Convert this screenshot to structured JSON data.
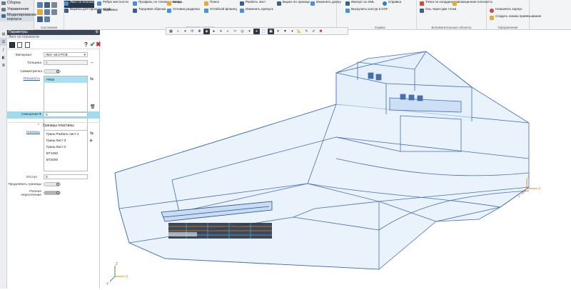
{
  "left_nav": {
    "items": [
      "Сборка",
      "Управление",
      "Моделирование корпуса"
    ]
  },
  "ribbon": {
    "group_labels": {
      "system": "Системная",
      "hull": "Элементы корпуса",
      "service": "Сервис",
      "aux": "Вспомогательные объекты",
      "design": "Оформление"
    },
    "buttons": {
      "sheet": "Лист по плоскости",
      "cutout": "Вырезы для прохода проф.",
      "rib": "Ребро жесткости",
      "stiffener": "Задвижка",
      "profile_points": "Профиль по точкам и напра...",
      "end_profile": "Торцевая обрезка",
      "bracket": "Кница",
      "corner_cut": "Угловая разделка",
      "search": "Поиск",
      "flange": "Отгибной фланец",
      "split_sheet": "Разбить лист",
      "change_allowance": "Изменить припуск",
      "cutout_border": "Вырез по границе",
      "change_length": "Изменить длину",
      "import_xml": "Импорт из XML",
      "help": "Справка",
      "export_dxf": "Выгрузить контур в DXF",
      "point_coords": "Точка по координатам",
      "axis_two_points": "Ось через две точки",
      "offset_plane": "Смещенная плоскость",
      "assign_hull": "Назначить корпус",
      "create_weld": "Создать линию привязывания"
    }
  },
  "panel": {
    "title": "Параметры",
    "subtitle": "Лист по плоскости",
    "material_label": "Материал",
    "material_value": "Лист s8.0 PCB",
    "thickness_label": "Толщина",
    "thickness_value": "8",
    "symmetric_label": "Симметрично",
    "plane_label": "Плоскость",
    "plane_value": "FR50",
    "offset_label": "Смещение",
    "offset_value": "0",
    "borders_section": "Границы пластины",
    "borders_label": "Границы",
    "borders_items": [
      "Грань:Разбить лист:1",
      "Грань:Лист:3",
      "Грань:Лист:2",
      "BT1250",
      "BT2000"
    ],
    "indent_label": "Отступ",
    "indent_value": "0",
    "extend_label": "Продлевать границы",
    "full_label": "Полное пересечение"
  },
  "view": {
    "axis_labels": [
      "X",
      "Y",
      "Z"
    ]
  },
  "colors": {
    "accent": "#29384a",
    "ok_green": "#1a9b3a",
    "cancel_red": "#d02424",
    "highlight": "#9fdcef",
    "hull_line": "#3f6fb8",
    "hull_fill": "#cfe1f7"
  }
}
